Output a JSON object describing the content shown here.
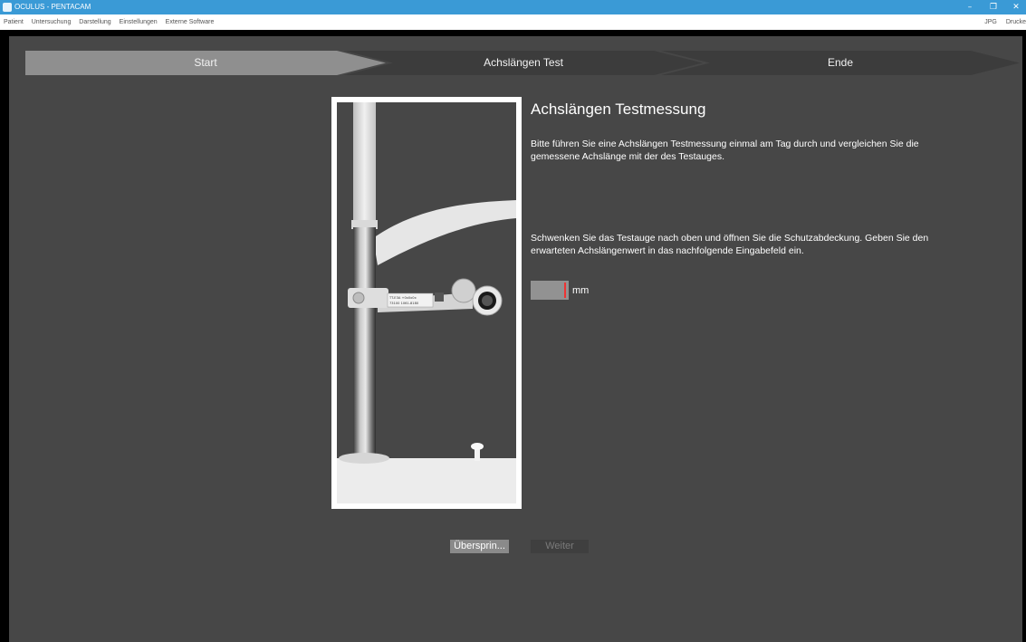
{
  "window": {
    "title": "OCULUS - PENTACAM",
    "minimize": "–",
    "maximize": "❐",
    "close": "✕"
  },
  "menu": {
    "items": [
      "Patient",
      "Untersuchung",
      "Darstellung",
      "Einstellungen",
      "Externe Software"
    ],
    "right": [
      "JPG",
      "Drucke"
    ]
  },
  "wizard": {
    "steps": [
      "Start",
      "Achslängen Test",
      "Ende"
    ],
    "active_step": 0,
    "colors": {
      "active": "#8f8f8f",
      "inactive": "#3c3c3c"
    }
  },
  "content": {
    "heading": "Achslängen Testmessung",
    "para1": "Bitte führen Sie eine Achslängen Testmessung einmal am Tag durch und vergleichen Sie die gemessene Achslänge mit der des Testauges.",
    "para2": "Schwenken Sie das Testauge nach oben und öffnen Sie die Schutzabdeckung. Geben Sie den erwarteten Achslängenwert in das nachfolgende Eingabefeld ein.",
    "input_value": "",
    "unit": "mm"
  },
  "photo": {
    "label_line1": "TT-E3A   +0x0x0x",
    "label_line2": "73100 1061-8180"
  },
  "buttons": {
    "skip": "Übersprin...",
    "next": "Weiter"
  }
}
